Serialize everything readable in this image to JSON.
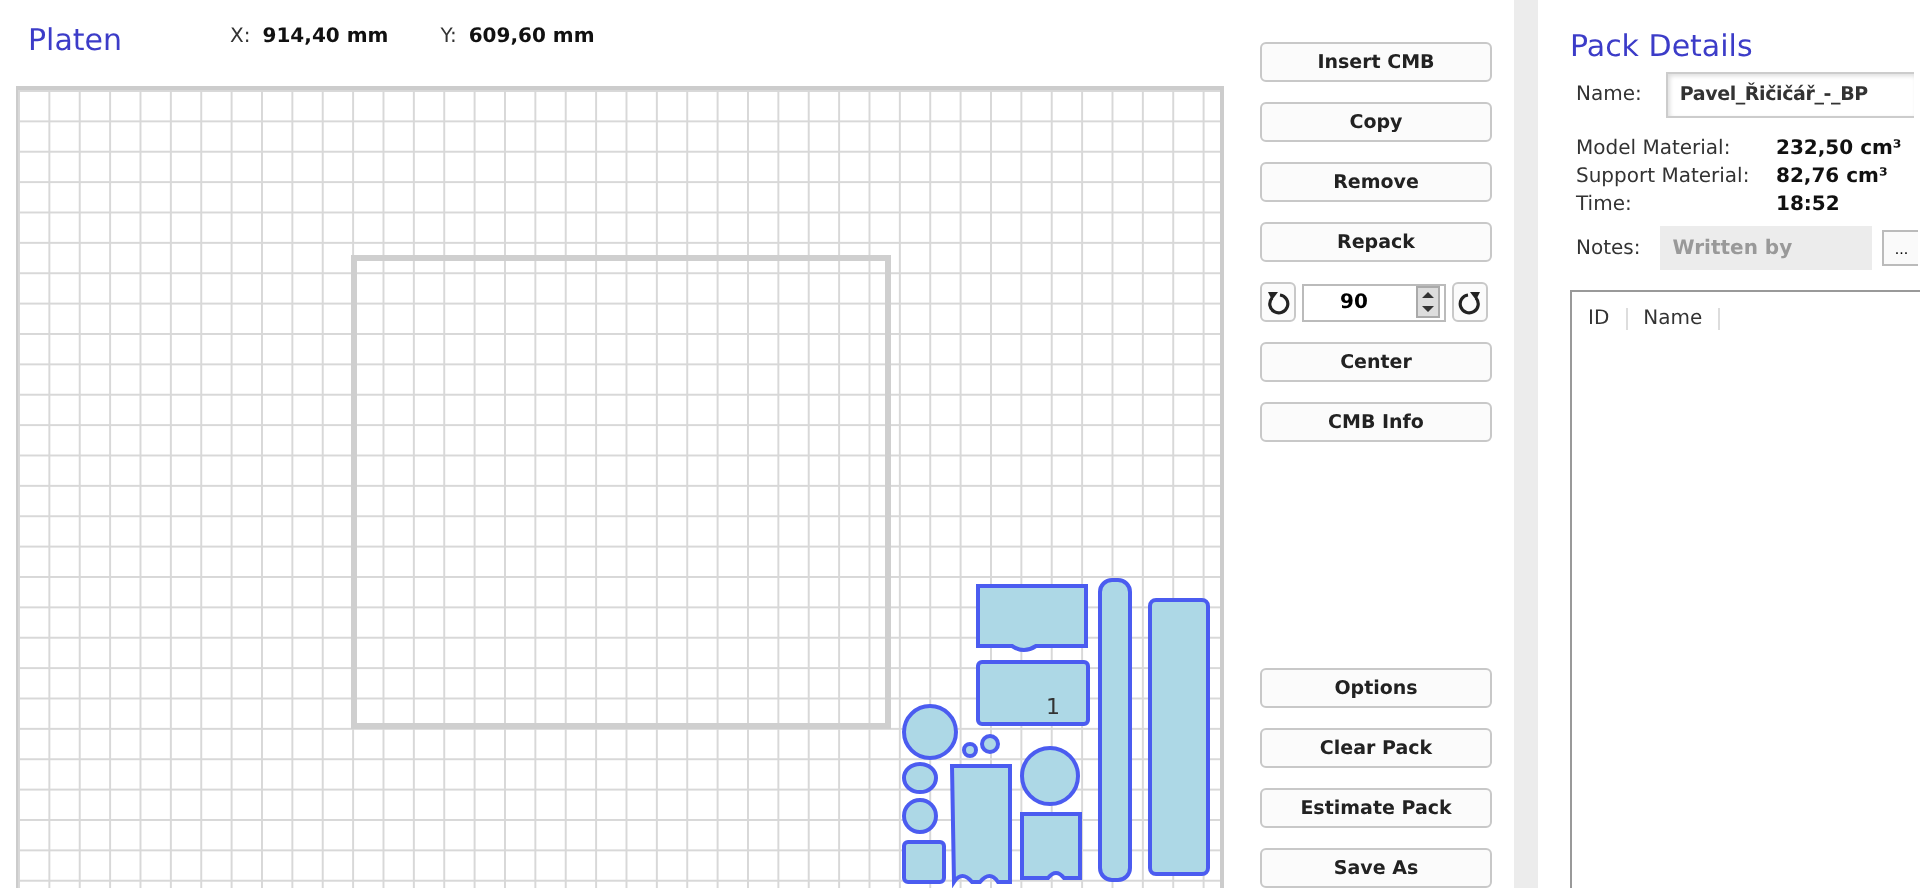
{
  "platen": {
    "title": "Platen",
    "x_label": "X:",
    "x_value": "914,40 mm",
    "y_label": "Y:",
    "y_value": "609,60 mm",
    "part_label": "1"
  },
  "buttons_top": [
    "Insert CMB",
    "Copy",
    "Remove",
    "Repack"
  ],
  "rotate": {
    "value": "90"
  },
  "buttons_mid": [
    "Center",
    "CMB Info"
  ],
  "buttons_bottom": [
    "Options",
    "Clear Pack",
    "Estimate Pack",
    "Save As"
  ],
  "pack_details": {
    "title": "Pack Details",
    "name_label": "Name:",
    "name_value": "Pavel_Řičičář_-_BP",
    "fields": [
      {
        "label": "Model Material:",
        "value": "232,50 cm³"
      },
      {
        "label": "Support Material:",
        "value": "82,76 cm³"
      },
      {
        "label": "Time:",
        "value": "18:52"
      }
    ],
    "notes_label": "Notes:",
    "notes_placeholder": "Written by",
    "browse_button": "...",
    "table": {
      "columns": [
        "ID",
        "Name"
      ]
    }
  }
}
